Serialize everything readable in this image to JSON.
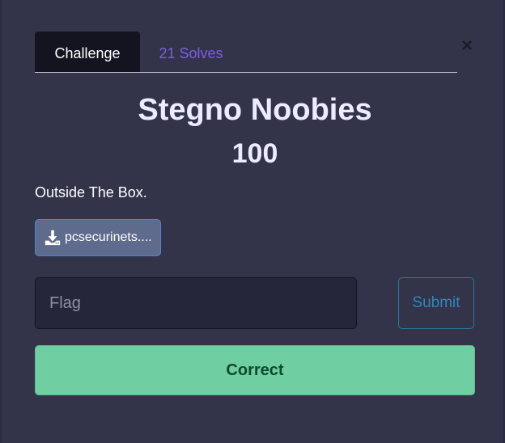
{
  "modal": {
    "close_glyph": "×",
    "tabs": [
      {
        "label": "Challenge",
        "active": true
      },
      {
        "label": "21 Solves",
        "active": false
      }
    ],
    "challenge": {
      "name": "Stegno Noobies",
      "points": "100",
      "description": "Outside The Box.",
      "file": {
        "label": "pcsecurinets....",
        "icon": "download-icon"
      }
    },
    "form": {
      "flag_placeholder": "Flag",
      "flag_value": "",
      "submit_label": "Submit"
    },
    "result": {
      "message": "Correct",
      "status": "success"
    }
  },
  "colors": {
    "background": "#33334a",
    "tab_active_bg": "#141420",
    "tab_inactive_text": "#7d5fe0",
    "title_text": "#ecebff",
    "file_button_bg": "#5f6b8c",
    "file_button_border": "#4b84d6",
    "input_bg": "#25263a",
    "submit_border": "#2a78a0",
    "success_bg": "#6fcfa3",
    "success_text": "#0c4a2f"
  }
}
